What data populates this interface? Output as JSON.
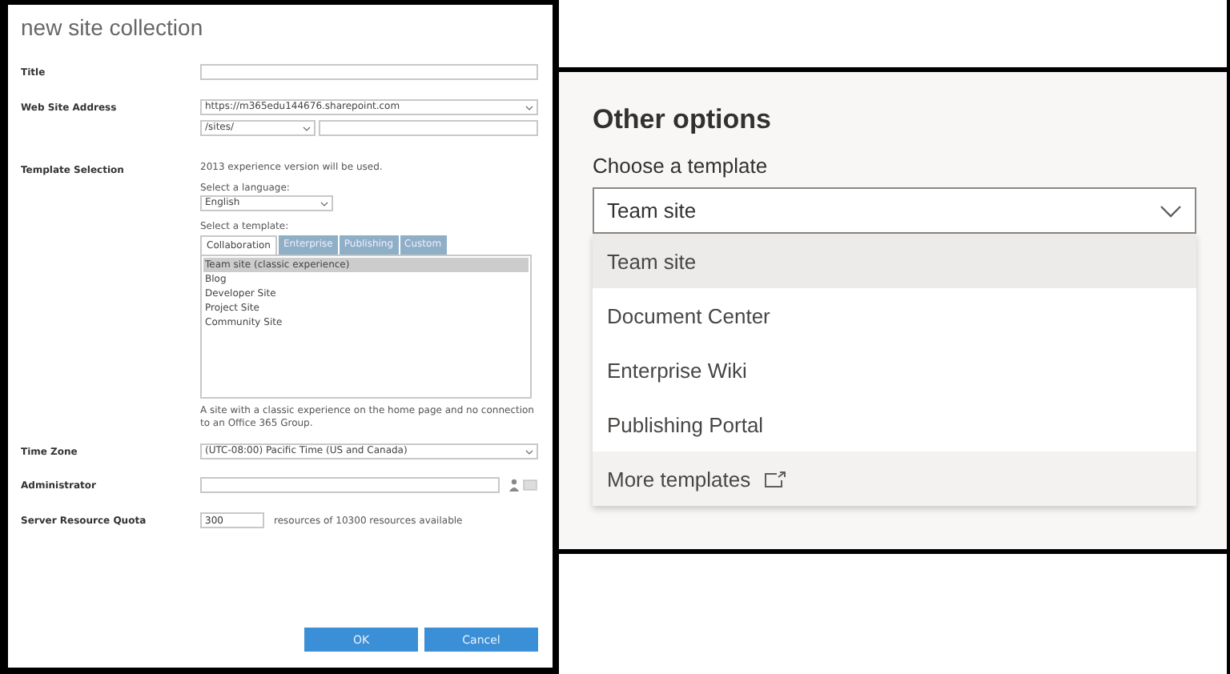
{
  "left_dialog": {
    "title": "new site collection",
    "title_field": {
      "label": "Title"
    },
    "address": {
      "label": "Web Site Address",
      "domain": "https://m365edu144676.sharepoint.com",
      "path": "/sites/"
    },
    "template_selection": {
      "label": "Template Selection",
      "note": "2013 experience version will be used.",
      "language_label": "Select a language:",
      "language": "English",
      "template_label": "Select a template:",
      "tabs": [
        {
          "label": "Collaboration",
          "selected": true
        },
        {
          "label": "Enterprise",
          "selected": false
        },
        {
          "label": "Publishing",
          "selected": false
        },
        {
          "label": "Custom",
          "selected": false
        }
      ],
      "templates": [
        {
          "label": "Team site (classic experience)",
          "selected": true
        },
        {
          "label": "Blog",
          "selected": false
        },
        {
          "label": "Developer Site",
          "selected": false
        },
        {
          "label": "Project Site",
          "selected": false
        },
        {
          "label": "Community Site",
          "selected": false
        }
      ],
      "description": "A site with a classic experience on the home page and no connection to an Office 365 Group."
    },
    "time_zone": {
      "label": "Time Zone",
      "value": "(UTC-08:00) Pacific Time (US and Canada)"
    },
    "administrator": {
      "label": "Administrator"
    },
    "quota": {
      "label": "Server Resource Quota",
      "value": "300",
      "note": "resources of 10300 resources available"
    },
    "buttons": [
      "OK",
      "Cancel"
    ]
  },
  "right_panel": {
    "title": "Other options",
    "label": "Choose a template",
    "value": "Team site",
    "options": [
      {
        "label": "Team site",
        "selected": true
      },
      {
        "label": "Document Center",
        "selected": false
      },
      {
        "label": "Enterprise Wiki",
        "selected": false
      },
      {
        "label": "Publishing Portal",
        "selected": false
      }
    ],
    "more_link": "More templates"
  }
}
